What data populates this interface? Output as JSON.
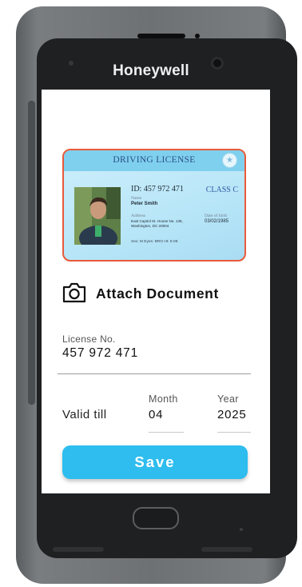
{
  "device": {
    "brand": "Honeywell"
  },
  "license_card": {
    "title": "DRIVING LICENSE",
    "id_text": "ID: 457 972 471",
    "class_text": "CLASS C",
    "name_label": "Name",
    "name_value": "Peter Smith",
    "address_label": "Address",
    "address_value": "East Capitol St. House No. 135, Washington, DC 20004",
    "dob_label": "Date of birth",
    "dob_value": "03/02/1985",
    "details_line": "Sex: M   Eyes: BRO   Ht: 5-08"
  },
  "attach": {
    "label": "Attach Document",
    "icon": "camera-icon"
  },
  "license_no": {
    "label": "License No.",
    "value": "457 972 471"
  },
  "valid_till": {
    "label": "Valid till",
    "month_label": "Month",
    "month_value": "04",
    "year_label": "Year",
    "year_value": "2025"
  },
  "save": {
    "label": "Save"
  },
  "colors": {
    "accent": "#2ebdee",
    "card_border": "#e85a3a",
    "card_header": "#7fd0ee"
  }
}
